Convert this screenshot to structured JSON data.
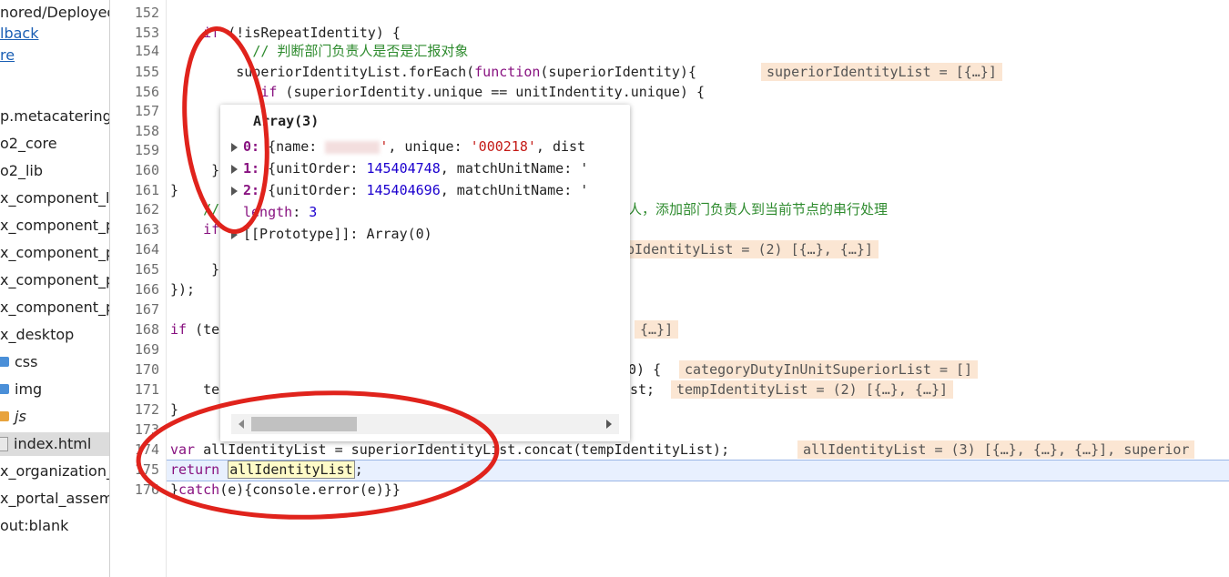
{
  "sidebar": {
    "items": [
      {
        "label": "nored/Deployed",
        "kind": "text"
      },
      {
        "label": "lback",
        "kind": "link"
      },
      {
        "label": "re",
        "kind": "link"
      },
      {
        "label": "p.metacatering.",
        "kind": "text"
      },
      {
        "label": "o2_core",
        "kind": "text"
      },
      {
        "label": "o2_lib",
        "kind": "text"
      },
      {
        "label": "x_component_l",
        "kind": "text"
      },
      {
        "label": "x_component_p",
        "kind": "text"
      },
      {
        "label": "x_component_p",
        "kind": "text"
      },
      {
        "label": "x_component_p",
        "kind": "text"
      },
      {
        "label": "x_component_p",
        "kind": "text"
      },
      {
        "label": "x_desktop",
        "kind": "text"
      },
      {
        "label": "css",
        "kind": "folder"
      },
      {
        "label": "img",
        "kind": "folder"
      },
      {
        "label": "js",
        "kind": "folder-italic"
      },
      {
        "label": "index.html",
        "kind": "file"
      },
      {
        "label": "x_organization_",
        "kind": "text"
      },
      {
        "label": "x_portal_assem",
        "kind": "text"
      },
      {
        "label": "out:blank",
        "kind": "text"
      }
    ]
  },
  "colors": {
    "folder_blue": "#4a8fd8",
    "folder_orange": "#e8a33d",
    "annotation_red": "#e0231c"
  },
  "code": {
    "l152": {
      "num": "152"
    },
    "l153": {
      "num": "153",
      "a": "if",
      "b": " (!isRepeatIdentity) {"
    },
    "l154": {
      "num": "154",
      "a": "// 判断部门负责人是否是汇报对象"
    },
    "l155": {
      "num": "155",
      "a": "superiorIdentityList.forEach(",
      "b": "function",
      "c": "(superiorIdentity){"
    },
    "l156": {
      "num": "156",
      "a": "if",
      "b": " (superiorIdentity.unique == unitIndentity.unique) {"
    },
    "l157": {
      "num": "157"
    },
    "l158": {
      "num": "158"
    },
    "l159": {
      "num": "159"
    },
    "l160": {
      "num": "160",
      "a": "}"
    },
    "l161": {
      "num": "161",
      "a": "}"
    },
    "l162": {
      "num": "162",
      "a": "//",
      "b": "人，添加部门负责人到当前节点的串行处理"
    },
    "l163": {
      "num": "163",
      "a": "if"
    },
    "l164": {
      "num": "164"
    },
    "l165": {
      "num": "165",
      "a": "}"
    },
    "l166": {
      "num": "166",
      "a": "});"
    },
    "l167": {
      "num": "167"
    },
    "l168": {
      "num": "168",
      "a": "if",
      "b": " (te"
    },
    "l169": {
      "num": "169"
    },
    "l170": {
      "num": "170",
      "a": "0) {"
    },
    "l171": {
      "num": "171",
      "a": "te",
      "b": "st;"
    },
    "l172": {
      "num": "172",
      "a": "}"
    },
    "l173": {
      "num": "173"
    },
    "l174": {
      "num": "174",
      "a": "var",
      "b": " allIdentityList = superiorIdentityList.concat(tempIdentityList);"
    },
    "l175": {
      "num": "175",
      "a": "return",
      "b": "allIdentityList",
      "c": ";"
    },
    "l176": {
      "num": "176",
      "a": "}",
      "b": "catch",
      "c": "(e){console.error(e)}}"
    }
  },
  "inline_values": {
    "v155": "superiorIdentityList = [{…}]",
    "v164": "pIdentityList = (2) [{…}, {…}]",
    "v168": "{…}]",
    "v170": "categoryDutyInUnitSuperiorList = []",
    "v171": "tempIdentityList = (2) [{…}, {…}]",
    "v174": "allIdentityList = (3) [{…}, {…}, {…}], superior"
  },
  "tooltip": {
    "title": "Array(3)",
    "entries": [
      {
        "key": "0:",
        "pre": " {name: ",
        "mid": "'",
        "s1": "'000218'",
        "post": ", dist",
        "uniq": ", unique: "
      },
      {
        "key": "1:",
        "pre": " {unitOrder: ",
        "n1": "145404748",
        "post": ", matchUnitName: '"
      },
      {
        "key": "2:",
        "pre": " {unitOrder: ",
        "n1": "145404696",
        "post": ", matchUnitName: '"
      }
    ],
    "length_label": "length",
    "length_value": "3",
    "proto": "[[Prototype]]: Array(0)"
  }
}
